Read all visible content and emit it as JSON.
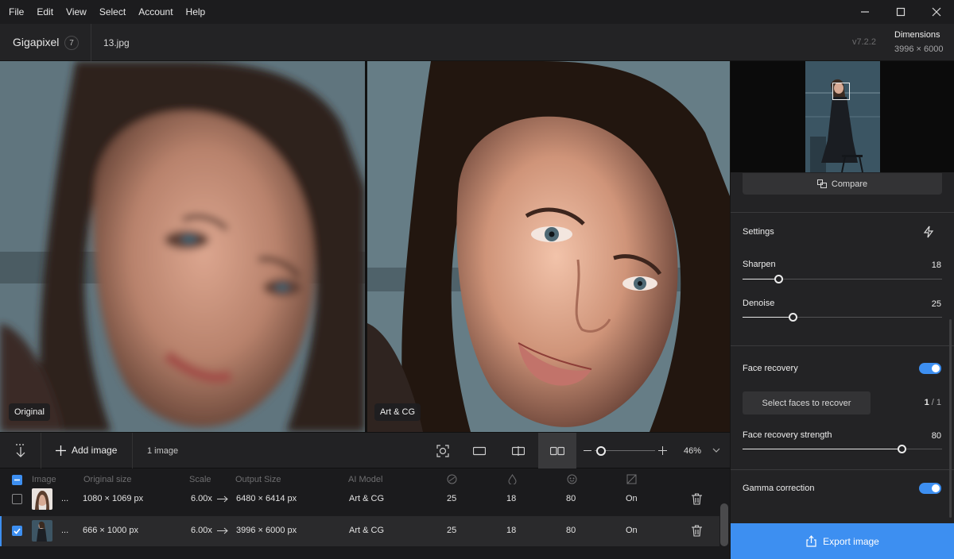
{
  "menu": [
    "File",
    "Edit",
    "View",
    "Select",
    "Account",
    "Help"
  ],
  "app": {
    "name": "Gigapixel",
    "badge": "7",
    "file": "13.jpg",
    "version": "v7.2.2"
  },
  "dimensions": {
    "label": "Dimensions",
    "value": "3996 × 6000"
  },
  "preview": {
    "left_label": "Original",
    "right_label": "Art & CG"
  },
  "toolbar": {
    "add_label": "Add image",
    "count": "1 image",
    "zoom": "46%",
    "zoom_level": 0.1
  },
  "table": {
    "headers": [
      "Image",
      "Original size",
      "Scale",
      "Output Size",
      "AI Model"
    ],
    "rows": [
      {
        "dots": "...",
        "original_size": "1080 × 1069 px",
        "scale": "6.00x",
        "output_size": "6480 × 6414 px",
        "model": "Art & CG",
        "v1": "25",
        "v2": "18",
        "v3": "80",
        "gamma": "On",
        "checked": false
      },
      {
        "dots": "...",
        "original_size": "666 × 1000 px",
        "scale": "6.00x",
        "output_size": "3996 × 6000 px",
        "model": "Art & CG",
        "v1": "25",
        "v2": "18",
        "v3": "80",
        "gamma": "On",
        "checked": true
      }
    ]
  },
  "side": {
    "compare_label": "Compare",
    "settings_title": "Settings",
    "sharpen_label": "Sharpen",
    "sharpen_value": "18",
    "denoise_label": "Denoise",
    "denoise_value": "25",
    "face_recovery_label": "Face recovery",
    "select_faces_label": "Select faces to recover",
    "faces_count": "1",
    "faces_total": "/ 1",
    "face_strength_label": "Face recovery strength",
    "face_strength_value": "80",
    "gamma_label": "Gamma correction",
    "export_label": "Export image"
  },
  "colors": {
    "accent": "#3d8ff1",
    "background": "#1d1d1f",
    "panel": "#232325"
  }
}
